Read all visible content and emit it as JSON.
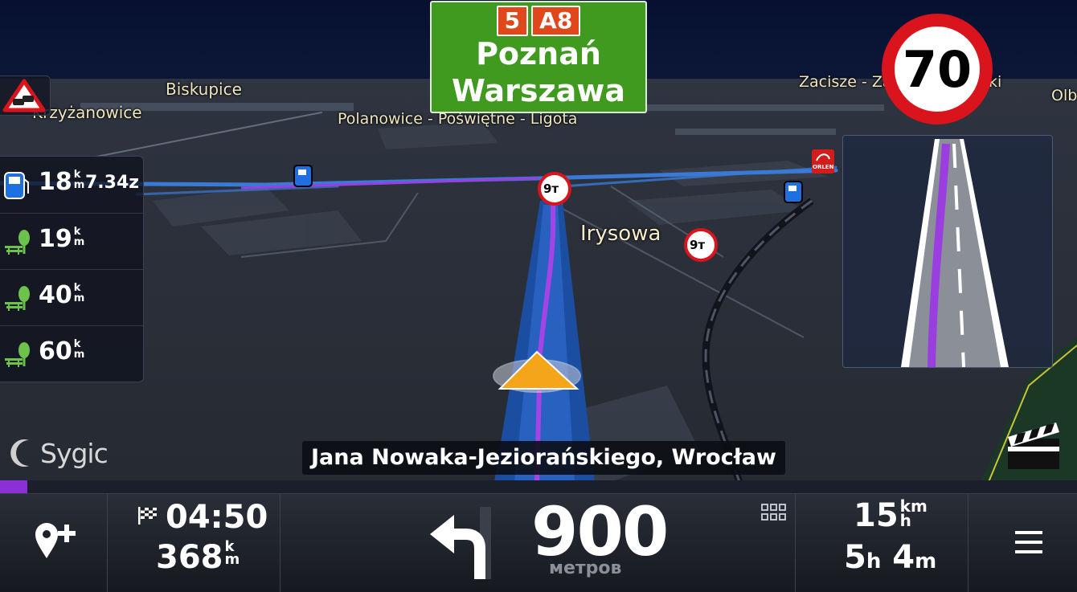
{
  "map": {
    "labels": {
      "krzyzanowice": "Krzyżanowice",
      "biskupice": "Biskupice",
      "polanowice": "Polanowice - Poświętne - Ligota",
      "zacisze": "Zacisze - Za",
      "zacisze_tail": "ki",
      "olb": "Olb",
      "irysowa": "Irysowa"
    },
    "weight_signs": [
      "9т",
      "9т"
    ],
    "orlen_label": "ORLEN"
  },
  "road_sign": {
    "shields": [
      "5",
      "A8"
    ],
    "destinations": [
      "Poznań",
      "Warszawa"
    ]
  },
  "speed_limit": "70",
  "poi_panel": {
    "rows": [
      {
        "icon": "fuel-icon",
        "distance": "18",
        "unit_top": "k",
        "unit_bottom": "m",
        "extra": "7.34z"
      },
      {
        "icon": "rest-area-icon",
        "distance": "19",
        "unit_top": "k",
        "unit_bottom": "m"
      },
      {
        "icon": "rest-area-icon",
        "distance": "40",
        "unit_top": "k",
        "unit_bottom": "m"
      },
      {
        "icon": "rest-area-icon",
        "distance": "60",
        "unit_top": "k",
        "unit_bottom": "m"
      }
    ]
  },
  "street_name": "Jana Nowaka-Jeziorańskiego, Wrocław",
  "logo": "Sygic",
  "route_progress": 0.025,
  "bottom_bar": {
    "eta_time": "04:50",
    "remaining_distance": "368",
    "remaining_unit_top": "k",
    "remaining_unit_bottom": "m",
    "turn_distance": "900",
    "turn_unit": "метров",
    "speed": "15",
    "speed_unit_top": "km",
    "speed_unit_bottom": "h",
    "duration_hours": "5",
    "duration_hours_unit": "h",
    "duration_minutes": "4",
    "duration_minutes_unit": "m"
  },
  "colors": {
    "route": "#9a3ee0",
    "road_sign_bg": "#3f9a1f",
    "shield_bg": "#e0471a",
    "speed_limit_ring": "#d9141c",
    "vehicle_arrow": "#f5a51a",
    "fuel_icon": "#1e6fe0",
    "progress": "#8d2fd6"
  }
}
